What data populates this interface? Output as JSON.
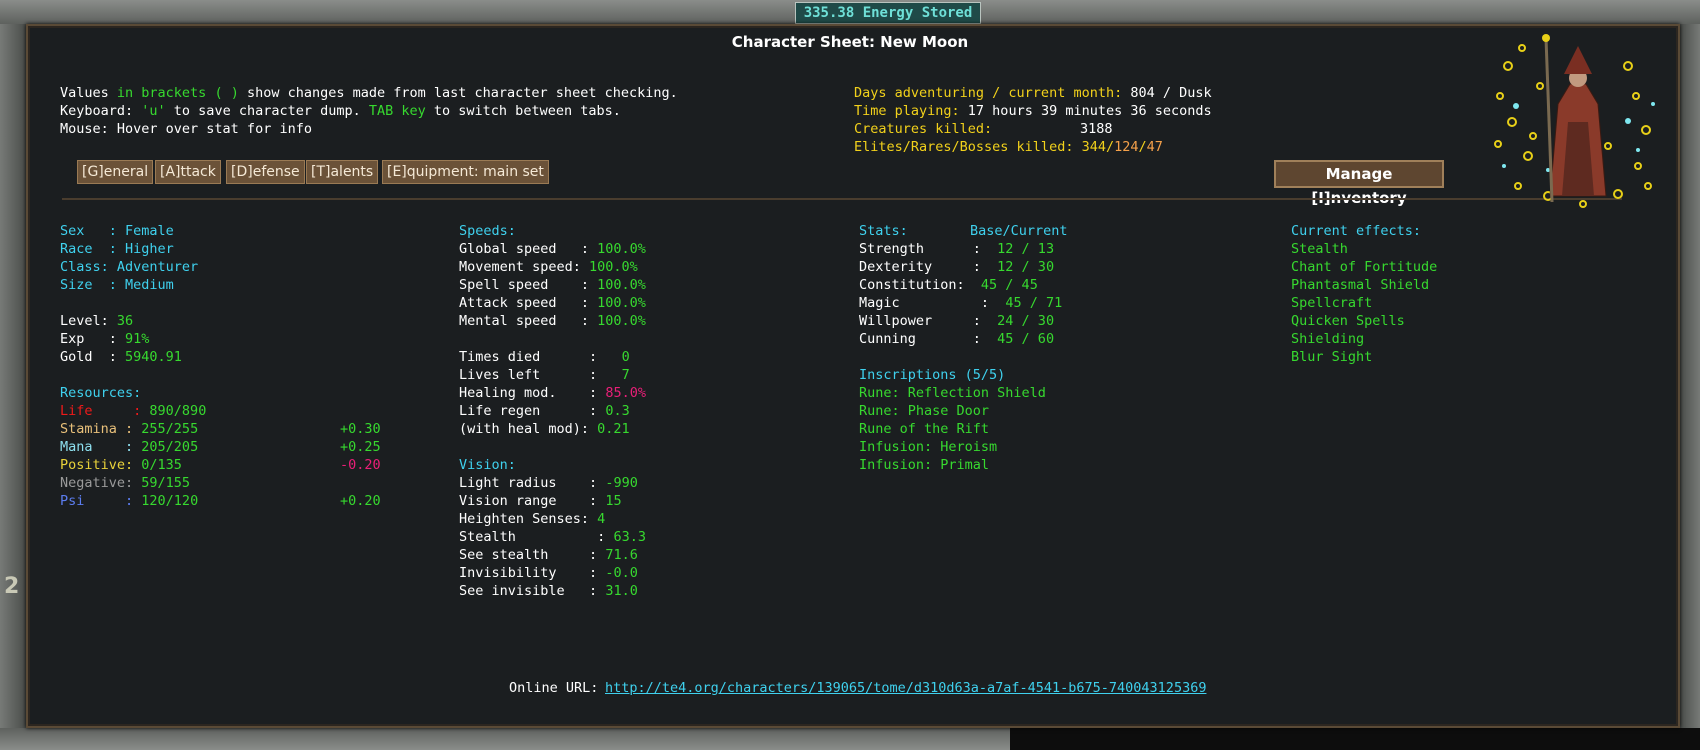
{
  "header": {
    "energy_text": "335.38 Energy Stored",
    "title": "Character Sheet: New Moon"
  },
  "info": {
    "line1_a": "Values ",
    "line1_b": "in brackets ( )",
    "line1_c": " show changes made from last character sheet checking.",
    "line2_a": "Keyboard: ",
    "line2_b": "'u'",
    "line2_c": " to save character dump. ",
    "line2_d": "TAB key",
    "line2_e": " to switch between tabs.",
    "line3": "Mouse: Hover over stat for info"
  },
  "summary": {
    "days_label": "Days adventuring / current month:",
    "days_value": " 804 / Dusk",
    "time_label": "Time playing:",
    "time_value": " 17 hours 39 minutes 36 seconds",
    "creatures_label": "Creatures killed:",
    "creatures_value": "3188",
    "elites_label": "Elites/Rares/Bosses killed:",
    "elites": "344",
    "rares": "124",
    "bosses": "47"
  },
  "tabs": [
    "[G]eneral",
    "[A]ttack",
    "[D]efense",
    "[T]alents",
    "[E]quipment: main set"
  ],
  "manage_button": "Manage [I]nventory",
  "character": {
    "sex": "Sex   : Female",
    "race": "Race  : Higher",
    "class": "Class: Adventurer",
    "size": "Size  : Medium",
    "level_label": "Level: ",
    "level": "36",
    "exp_label": "Exp   : ",
    "exp": "91%",
    "gold_label": "Gold  : ",
    "gold": "5940.91"
  },
  "resources": {
    "title": "Resources:",
    "items": [
      {
        "name": "Life",
        "sep": "     : ",
        "value": "890/890",
        "regen": ""
      },
      {
        "name": "Stamina",
        "sep": " : ",
        "value": "255/255",
        "regen": "+0.30"
      },
      {
        "name": "Mana",
        "sep": "    : ",
        "value": "205/205",
        "regen": "+0.25"
      },
      {
        "name": "Positive",
        "sep": ": ",
        "value": "0/135",
        "regen": "-0.20"
      },
      {
        "name": "Negative",
        "sep": ": ",
        "value": "59/155",
        "regen": ""
      },
      {
        "name": "Psi",
        "sep": "     : ",
        "value": "120/120",
        "regen": "+0.20"
      }
    ]
  },
  "speeds": {
    "title": "Speeds:",
    "items": [
      {
        "label": "Global speed   : ",
        "value": "100.0%"
      },
      {
        "label": "Movement speed: ",
        "value": "100.0%"
      },
      {
        "label": "Spell speed    : ",
        "value": "100.0%"
      },
      {
        "label": "Attack speed   : ",
        "value": "100.0%"
      },
      {
        "label": "Mental speed   : ",
        "value": "100.0%"
      }
    ]
  },
  "life_stats": {
    "items": [
      {
        "label": "Times died      :   ",
        "value": "0"
      },
      {
        "label": "Lives left      :   ",
        "value": "7"
      },
      {
        "label": "Healing mod.    : ",
        "value": "85.0%"
      },
      {
        "label": "Life regen      : ",
        "value": "0.3"
      },
      {
        "label": "(with heal mod): ",
        "value": "0.21"
      }
    ]
  },
  "vision": {
    "title": "Vision:",
    "items": [
      {
        "label": "Light radius    : ",
        "value": "-990"
      },
      {
        "label": "Vision range    : ",
        "value": "15"
      },
      {
        "label": "Heighten Senses: ",
        "value": "4"
      },
      {
        "label": "Stealth          : ",
        "value": "63.3"
      },
      {
        "label": "See stealth     : ",
        "value": "71.6"
      },
      {
        "label": "Invisibility    : ",
        "value": "-0.0"
      },
      {
        "label": "See invisible   : ",
        "value": "31.0"
      }
    ]
  },
  "stats": {
    "title": "Stats:",
    "header": "Base/Current",
    "items": [
      {
        "label": "Strength      :  ",
        "value": "12 / 13"
      },
      {
        "label": "Dexterity     :  ",
        "value": "12 / 30"
      },
      {
        "label": "Constitution:  ",
        "value": "45 / 45"
      },
      {
        "label": "Magic          :  ",
        "value": "45 / 71"
      },
      {
        "label": "Willpower     :  ",
        "value": "24 / 30"
      },
      {
        "label": "Cunning       :  ",
        "value": "45 / 60"
      }
    ]
  },
  "inscriptions": {
    "title": "Inscriptions (5/5)",
    "items": [
      "Rune: Reflection Shield",
      "Rune: Phase Door",
      "Rune of the Rift",
      "Infusion: Heroism",
      "Infusion: Primal"
    ]
  },
  "effects": {
    "title": "Current effects:",
    "items": [
      "Stealth",
      "Chant of Fortitude",
      "Phantasmal Shield",
      "Spellcraft",
      "Quicken Spells",
      "Shielding",
      "Blur Sight"
    ]
  },
  "footer": {
    "url_label": "Online URL: ",
    "url": "http://te4.org/characters/139065/tome/d310d63a-a7af-4541-b675-740043125369"
  },
  "sidebar_glyph": "2"
}
